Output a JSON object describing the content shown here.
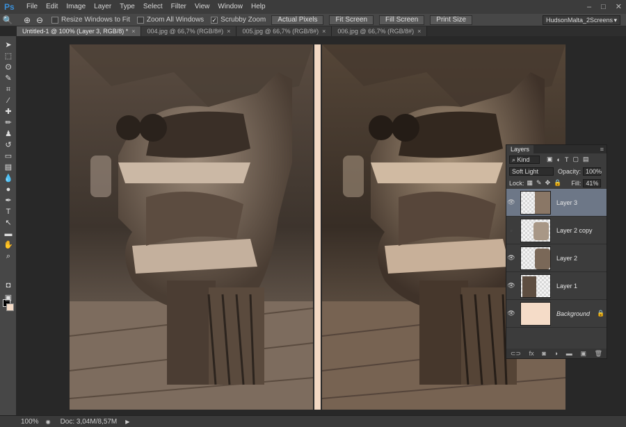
{
  "app": {
    "logo": "Ps",
    "window_controls": [
      "–",
      "□",
      "✕"
    ]
  },
  "menu": [
    "File",
    "Edit",
    "Image",
    "Layer",
    "Type",
    "Select",
    "Filter",
    "View",
    "Window",
    "Help"
  ],
  "options": {
    "zoom_in_icon": "zoom-in-icon",
    "zoom_out_icon": "zoom-out-icon",
    "resize_windows": {
      "label": "Resize Windows to Fit",
      "checked": false
    },
    "zoom_all": {
      "label": "Zoom All Windows",
      "checked": false
    },
    "scrubby_zoom": {
      "label": "Scrubby Zoom",
      "checked": true
    },
    "buttons": [
      "Actual Pixels",
      "Fit Screen",
      "Fill Screen",
      "Print Size"
    ],
    "workspace": "HudsonMalta_2Screens"
  },
  "tabs": [
    {
      "label": "Untitled-1 @ 100% (Layer 3, RGB/8) *",
      "active": true
    },
    {
      "label": "004.jpg @ 66,7% (RGB/8#)",
      "active": false
    },
    {
      "label": "005.jpg @ 66,7% (RGB/8#)",
      "active": false
    },
    {
      "label": "006.jpg @ 66,7% (RGB/8#)",
      "active": false
    }
  ],
  "status": {
    "zoom": "100%",
    "doc": "Doc: 3,04M/8,57M",
    "arrow": "▶"
  },
  "layers_panel": {
    "title": "Layers",
    "filter": "Kind",
    "blend_mode": "Soft Light",
    "opacity_label": "Opacity:",
    "opacity": "100%",
    "lock_label": "Lock:",
    "fill_label": "Fill:",
    "fill": "41%",
    "layers": [
      {
        "name": "Layer 3",
        "visible": true,
        "selected": true
      },
      {
        "name": "Layer 2 copy",
        "visible": false,
        "selected": false
      },
      {
        "name": "Layer 2",
        "visible": true,
        "selected": false
      },
      {
        "name": "Layer 1",
        "visible": true,
        "selected": false
      },
      {
        "name": "Background",
        "visible": true,
        "selected": false,
        "locked": true
      }
    ]
  },
  "colors": {
    "sepia_light": "#f3d9c4",
    "foreground": "#000000",
    "background": "#f5dcc8"
  }
}
